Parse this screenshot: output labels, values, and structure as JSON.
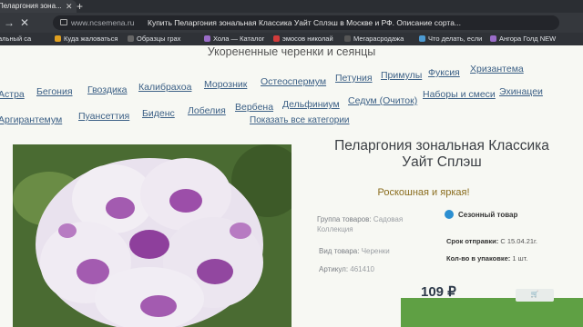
{
  "browser": {
    "tab_title": "Пеларгония зона...",
    "url": "www.ncsemena.ru",
    "page_title": "Купить Пеларгония зональная Классика Уайт Сплэш в Москве и РФ. Описание сорта..."
  },
  "bookmarks": [
    {
      "label": "альный са",
      "color": "#4c7ac9"
    },
    {
      "label": "Куда жаловаться",
      "color": "#e0a020"
    },
    {
      "label": "Образцы грах",
      "color": "#666"
    },
    {
      "label": "Хола — Каталог",
      "color": "#9a6cc8"
    },
    {
      "label": "эмосов николай",
      "color": "#d23b3b"
    },
    {
      "label": "Мегарасродажа",
      "color": "#555"
    },
    {
      "label": "Что делать, если",
      "color": "#4c9ad2"
    },
    {
      "label": "Ангора Голд NEW",
      "color": "#9a6cc8"
    }
  ],
  "section_title": "Укорененные черенки и сеянцы",
  "categories_row1": [
    "Астра",
    "Бегония",
    "Гвоздика",
    "Калибрахоа",
    "Морозник",
    "Остеоспермум",
    "Петуния",
    "Примулы",
    "Фуксия",
    "Хризантема"
  ],
  "categories_row2": [
    "Наборы и смеси",
    "Эхинацеи"
  ],
  "categories_row3": [
    "Аргирантемум",
    "Пуансеттия",
    "Биденс",
    "Лобелия",
    "Вербена",
    "Дельфиниум",
    "Седум (Очиток)"
  ],
  "show_all": "Показать все категории",
  "product": {
    "title_line1": "Пеларгония зональная Классика",
    "title_line2": "Уайт Сплэш",
    "slogan": "Роскошная и яркая!",
    "group_label": "Группа товаров:",
    "group_value": "Садовая",
    "group_value2": "Коллекция",
    "type_label": "Вид товара:",
    "type_value": "Черенки",
    "sku_label": "Артикул:",
    "sku_value": "461410",
    "badge": "Сезонный товар",
    "ship_label": "Срок отправки:",
    "ship_value": "С 15.04.21г.",
    "pack_label": "Кол-во в упаковке:",
    "pack_value": "1 шт.",
    "price": "109 ₽"
  },
  "colors": {
    "link": "#3b5f85",
    "badge": "#2c8fd1",
    "slogan": "#8a6d1e"
  }
}
